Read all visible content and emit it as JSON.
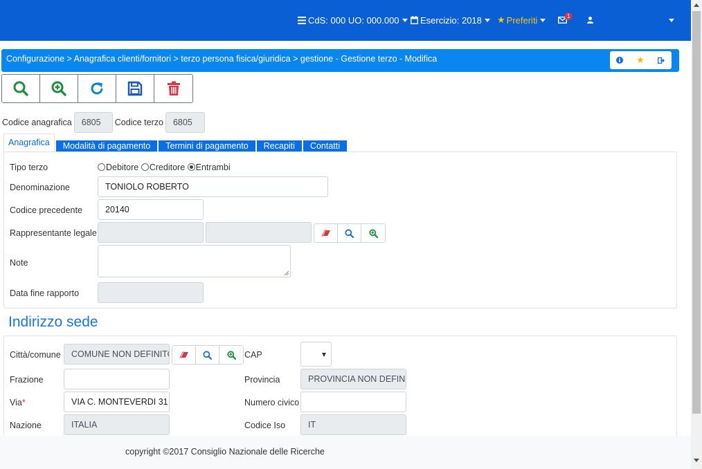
{
  "topbar": {
    "cds": "CdS: 000 UO: 000.000",
    "esercizio": "Esercizio: 2018",
    "preferiti": "Preferiti",
    "mail_count": "1",
    "colors": {
      "bg": "#0a5fd4",
      "star": "#f5c518"
    }
  },
  "breadcrumb": {
    "text": "Configurazione > Anagrafica clienti/fornitori > terzo persona fisica/giuridica > gestione - Gestione terzo - Modifica"
  },
  "toolbar": {
    "buttons": [
      {
        "icon": "search-icon"
      },
      {
        "icon": "zoom-in-icon"
      },
      {
        "icon": "refresh-icon"
      },
      {
        "icon": "save-icon"
      },
      {
        "icon": "trash-icon"
      }
    ]
  },
  "codes": {
    "codice_anagrafica_label": "Codice anagrafica",
    "codice_anagrafica_value": "6805",
    "codice_terzo_label": "Codice terzo",
    "codice_terzo_value": "6805"
  },
  "tabs": [
    "Anagrafica",
    "Modalità di pagamento",
    "Termini di pagamento",
    "Recapiti",
    "Contatti"
  ],
  "anagrafica": {
    "tipo_terzo_label": "Tipo terzo",
    "radio_options": [
      "Debitore",
      "Creditore",
      "Entrambi"
    ],
    "radio_selected": "Entrambi",
    "denominazione_label": "Denominazione",
    "denominazione_value": "TONIOLO ROBERTO",
    "codice_precedente_label": "Codice precedente",
    "codice_precedente_value": "20140",
    "rappresentante_label": "Rappresentante legale",
    "note_label": "Note",
    "data_fine_label": "Data fine rapporto"
  },
  "sede": {
    "title": "Indirizzo sede",
    "citta_label": "Città/comune",
    "citta_value": "COMUNE NON DEFINITO",
    "cap_label": "CAP",
    "frazione_label": "Frazione",
    "provincia_label": "Provincia",
    "provincia_value": "PROVINCIA NON DEFINITA",
    "via_label": "Via",
    "via_required": "*",
    "via_value": "VIA C. MONTEVERDI 31",
    "numero_civico_label": "Numero civico",
    "nazione_label": "Nazione",
    "nazione_value": "ITALIA",
    "codice_iso_label": "Codice Iso",
    "codice_iso_value": "IT"
  },
  "footer": {
    "copyright": "copyright ©2017 Consiglio Nazionale delle Ricerche"
  }
}
